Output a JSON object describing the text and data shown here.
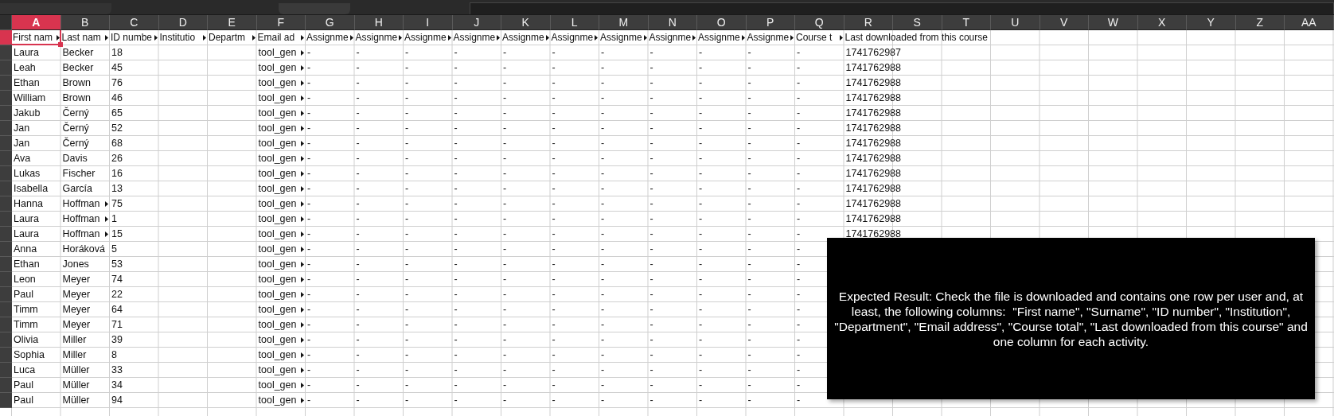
{
  "columns": [
    {
      "letter": "A",
      "selected": true
    },
    {
      "letter": "B",
      "selected": false
    },
    {
      "letter": "C",
      "selected": false
    },
    {
      "letter": "D",
      "selected": false
    },
    {
      "letter": "E",
      "selected": false
    },
    {
      "letter": "F",
      "selected": false
    },
    {
      "letter": "G",
      "selected": false
    },
    {
      "letter": "H",
      "selected": false
    },
    {
      "letter": "I",
      "selected": false
    },
    {
      "letter": "J",
      "selected": false
    },
    {
      "letter": "K",
      "selected": false
    },
    {
      "letter": "L",
      "selected": false
    },
    {
      "letter": "M",
      "selected": false
    },
    {
      "letter": "N",
      "selected": false
    },
    {
      "letter": "O",
      "selected": false
    },
    {
      "letter": "P",
      "selected": false
    },
    {
      "letter": "Q",
      "selected": false
    },
    {
      "letter": "R",
      "selected": false
    },
    {
      "letter": "S",
      "selected": false
    },
    {
      "letter": "T",
      "selected": false
    },
    {
      "letter": "U",
      "selected": false
    },
    {
      "letter": "V",
      "selected": false
    },
    {
      "letter": "W",
      "selected": false
    },
    {
      "letter": "X",
      "selected": false
    },
    {
      "letter": "Y",
      "selected": false
    },
    {
      "letter": "Z",
      "selected": false
    },
    {
      "letter": "AA",
      "selected": false
    }
  ],
  "rows": [
    {
      "selected": true,
      "cells": {
        "A": "First nam",
        "B": "Last nam",
        "C": "ID numbe",
        "D": "Institutio",
        "E": "Departm",
        "F": "Email ad",
        "G": "Assignme",
        "H": "Assignme",
        "I": "Assignme",
        "J": "Assignme",
        "K": "Assignme",
        "L": "Assignme",
        "M": "Assignme",
        "N": "Assignme",
        "O": "Assignme",
        "P": "Assignme",
        "Q": "Course t",
        "R": "Last downloaded from this course"
      },
      "clipped": {
        "A": true,
        "B": true,
        "C": true,
        "D": true,
        "E": true,
        "F": true,
        "G": true,
        "H": true,
        "I": true,
        "J": true,
        "K": true,
        "L": true,
        "M": true,
        "N": true,
        "O": true,
        "P": true,
        "Q": true
      }
    },
    {
      "selected": false,
      "cells": {
        "A": "Laura",
        "B": "Becker",
        "C": "18",
        "F": "tool_gen",
        "G": "-",
        "H": "-",
        "I": "-",
        "J": "-",
        "K": "-",
        "L": "-",
        "M": "-",
        "N": "-",
        "O": "-",
        "P": "-",
        "Q": "-",
        "R": "1741762987"
      },
      "clipped": {
        "F": true
      }
    },
    {
      "selected": false,
      "cells": {
        "A": "Leah",
        "B": "Becker",
        "C": "45",
        "F": "tool_gen",
        "G": "-",
        "H": "-",
        "I": "-",
        "J": "-",
        "K": "-",
        "L": "-",
        "M": "-",
        "N": "-",
        "O": "-",
        "P": "-",
        "Q": "-",
        "R": "1741762988"
      },
      "clipped": {
        "F": true
      }
    },
    {
      "selected": false,
      "cells": {
        "A": "Ethan",
        "B": "Brown",
        "C": "76",
        "F": "tool_gen",
        "G": "-",
        "H": "-",
        "I": "-",
        "J": "-",
        "K": "-",
        "L": "-",
        "M": "-",
        "N": "-",
        "O": "-",
        "P": "-",
        "Q": "-",
        "R": "1741762988"
      },
      "clipped": {
        "F": true
      }
    },
    {
      "selected": false,
      "cells": {
        "A": "William",
        "B": "Brown",
        "C": "46",
        "F": "tool_gen",
        "G": "-",
        "H": "-",
        "I": "-",
        "J": "-",
        "K": "-",
        "L": "-",
        "M": "-",
        "N": "-",
        "O": "-",
        "P": "-",
        "Q": "-",
        "R": "1741762988"
      },
      "clipped": {
        "F": true
      }
    },
    {
      "selected": false,
      "cells": {
        "A": "Jakub",
        "B": "Černý",
        "C": "65",
        "F": "tool_gen",
        "G": "-",
        "H": "-",
        "I": "-",
        "J": "-",
        "K": "-",
        "L": "-",
        "M": "-",
        "N": "-",
        "O": "-",
        "P": "-",
        "Q": "-",
        "R": "1741762988"
      },
      "clipped": {
        "F": true
      }
    },
    {
      "selected": false,
      "cells": {
        "A": "Jan",
        "B": "Černý",
        "C": "52",
        "F": "tool_gen",
        "G": "-",
        "H": "-",
        "I": "-",
        "J": "-",
        "K": "-",
        "L": "-",
        "M": "-",
        "N": "-",
        "O": "-",
        "P": "-",
        "Q": "-",
        "R": "1741762988"
      },
      "clipped": {
        "F": true
      }
    },
    {
      "selected": false,
      "cells": {
        "A": "Jan",
        "B": "Černý",
        "C": "68",
        "F": "tool_gen",
        "G": "-",
        "H": "-",
        "I": "-",
        "J": "-",
        "K": "-",
        "L": "-",
        "M": "-",
        "N": "-",
        "O": "-",
        "P": "-",
        "Q": "-",
        "R": "1741762988"
      },
      "clipped": {
        "F": true
      }
    },
    {
      "selected": false,
      "cells": {
        "A": "Ava",
        "B": "Davis",
        "C": "26",
        "F": "tool_gen",
        "G": "-",
        "H": "-",
        "I": "-",
        "J": "-",
        "K": "-",
        "L": "-",
        "M": "-",
        "N": "-",
        "O": "-",
        "P": "-",
        "Q": "-",
        "R": "1741762988"
      },
      "clipped": {
        "F": true
      }
    },
    {
      "selected": false,
      "cells": {
        "A": "Lukas",
        "B": "Fischer",
        "C": "16",
        "F": "tool_gen",
        "G": "-",
        "H": "-",
        "I": "-",
        "J": "-",
        "K": "-",
        "L": "-",
        "M": "-",
        "N": "-",
        "O": "-",
        "P": "-",
        "Q": "-",
        "R": "1741762988"
      },
      "clipped": {
        "F": true
      }
    },
    {
      "selected": false,
      "cells": {
        "A": "Isabella",
        "B": "García",
        "C": "13",
        "F": "tool_gen",
        "G": "-",
        "H": "-",
        "I": "-",
        "J": "-",
        "K": "-",
        "L": "-",
        "M": "-",
        "N": "-",
        "O": "-",
        "P": "-",
        "Q": "-",
        "R": "1741762988"
      },
      "clipped": {
        "F": true
      }
    },
    {
      "selected": false,
      "cells": {
        "A": "Hanna",
        "B": "Hoffman",
        "C": "75",
        "F": "tool_gen",
        "G": "-",
        "H": "-",
        "I": "-",
        "J": "-",
        "K": "-",
        "L": "-",
        "M": "-",
        "N": "-",
        "O": "-",
        "P": "-",
        "Q": "-",
        "R": "1741762988"
      },
      "clipped": {
        "B": true,
        "F": true
      }
    },
    {
      "selected": false,
      "cells": {
        "A": "Laura",
        "B": "Hoffman",
        "C": "1",
        "F": "tool_gen",
        "G": "-",
        "H": "-",
        "I": "-",
        "J": "-",
        "K": "-",
        "L": "-",
        "M": "-",
        "N": "-",
        "O": "-",
        "P": "-",
        "Q": "-",
        "R": "1741762988"
      },
      "clipped": {
        "B": true,
        "F": true
      }
    },
    {
      "selected": false,
      "cells": {
        "A": "Laura",
        "B": "Hoffman",
        "C": "15",
        "F": "tool_gen",
        "G": "-",
        "H": "-",
        "I": "-",
        "J": "-",
        "K": "-",
        "L": "-",
        "M": "-",
        "N": "-",
        "O": "-",
        "P": "-",
        "Q": "-",
        "R": "1741762988"
      },
      "clipped": {
        "B": true,
        "F": true
      }
    },
    {
      "selected": false,
      "cells": {
        "A": "Anna",
        "B": "Horáková",
        "C": "5",
        "F": "tool_gen",
        "G": "-",
        "H": "-",
        "I": "-",
        "J": "-",
        "K": "-",
        "L": "-",
        "M": "-",
        "N": "-",
        "O": "-",
        "P": "-",
        "Q": "-"
      },
      "clipped": {
        "F": true
      }
    },
    {
      "selected": false,
      "cells": {
        "A": "Ethan",
        "B": "Jones",
        "C": "53",
        "F": "tool_gen",
        "G": "-",
        "H": "-",
        "I": "-",
        "J": "-",
        "K": "-",
        "L": "-",
        "M": "-",
        "N": "-",
        "O": "-",
        "P": "-",
        "Q": "-"
      },
      "clipped": {
        "F": true
      }
    },
    {
      "selected": false,
      "cells": {
        "A": "Leon",
        "B": "Meyer",
        "C": "74",
        "F": "tool_gen",
        "G": "-",
        "H": "-",
        "I": "-",
        "J": "-",
        "K": "-",
        "L": "-",
        "M": "-",
        "N": "-",
        "O": "-",
        "P": "-",
        "Q": "-"
      },
      "clipped": {
        "F": true
      }
    },
    {
      "selected": false,
      "cells": {
        "A": "Paul",
        "B": "Meyer",
        "C": "22",
        "F": "tool_gen",
        "G": "-",
        "H": "-",
        "I": "-",
        "J": "-",
        "K": "-",
        "L": "-",
        "M": "-",
        "N": "-",
        "O": "-",
        "P": "-",
        "Q": "-"
      },
      "clipped": {
        "F": true
      }
    },
    {
      "selected": false,
      "cells": {
        "A": "Timm",
        "B": "Meyer",
        "C": "64",
        "F": "tool_gen",
        "G": "-",
        "H": "-",
        "I": "-",
        "J": "-",
        "K": "-",
        "L": "-",
        "M": "-",
        "N": "-",
        "O": "-",
        "P": "-",
        "Q": "-"
      },
      "clipped": {
        "F": true
      }
    },
    {
      "selected": false,
      "cells": {
        "A": "Timm",
        "B": "Meyer",
        "C": "71",
        "F": "tool_gen",
        "G": "-",
        "H": "-",
        "I": "-",
        "J": "-",
        "K": "-",
        "L": "-",
        "M": "-",
        "N": "-",
        "O": "-",
        "P": "-",
        "Q": "-"
      },
      "clipped": {
        "F": true
      }
    },
    {
      "selected": false,
      "cells": {
        "A": "Olivia",
        "B": "Miller",
        "C": "39",
        "F": "tool_gen",
        "G": "-",
        "H": "-",
        "I": "-",
        "J": "-",
        "K": "-",
        "L": "-",
        "M": "-",
        "N": "-",
        "O": "-",
        "P": "-",
        "Q": "-"
      },
      "clipped": {
        "F": true
      }
    },
    {
      "selected": false,
      "cells": {
        "A": "Sophia",
        "B": "Miller",
        "C": "8",
        "F": "tool_gen",
        "G": "-",
        "H": "-",
        "I": "-",
        "J": "-",
        "K": "-",
        "L": "-",
        "M": "-",
        "N": "-",
        "O": "-",
        "P": "-",
        "Q": "-"
      },
      "clipped": {
        "F": true
      }
    },
    {
      "selected": false,
      "cells": {
        "A": "Luca",
        "B": "Müller",
        "C": "33",
        "F": "tool_gen",
        "G": "-",
        "H": "-",
        "I": "-",
        "J": "-",
        "K": "-",
        "L": "-",
        "M": "-",
        "N": "-",
        "O": "-",
        "P": "-",
        "Q": "-"
      },
      "clipped": {
        "F": true
      }
    },
    {
      "selected": false,
      "cells": {
        "A": "Paul",
        "B": "Müller",
        "C": "34",
        "F": "tool_gen",
        "G": "-",
        "H": "-",
        "I": "-",
        "J": "-",
        "K": "-",
        "L": "-",
        "M": "-",
        "N": "-",
        "O": "-",
        "P": "-",
        "Q": "-"
      },
      "clipped": {
        "F": true
      }
    },
    {
      "selected": false,
      "cells": {
        "A": "Paul",
        "B": "Müller",
        "C": "94",
        "F": "tool_gen",
        "G": "-",
        "H": "-",
        "I": "-",
        "J": "-",
        "K": "-",
        "L": "-",
        "M": "-",
        "N": "-",
        "O": "-",
        "P": "-",
        "Q": "-"
      },
      "clipped": {
        "F": true
      }
    }
  ],
  "note": {
    "text": "Expected Result: Check the file is downloaded and contains one row per user and, at least, the following columns:  \"First name\", \"Surname\", \"ID number\", \"Institution\", \"Department\", \"Email address\", \"Course total\", \"Last downloaded from this course\" and one column for each activity."
  }
}
